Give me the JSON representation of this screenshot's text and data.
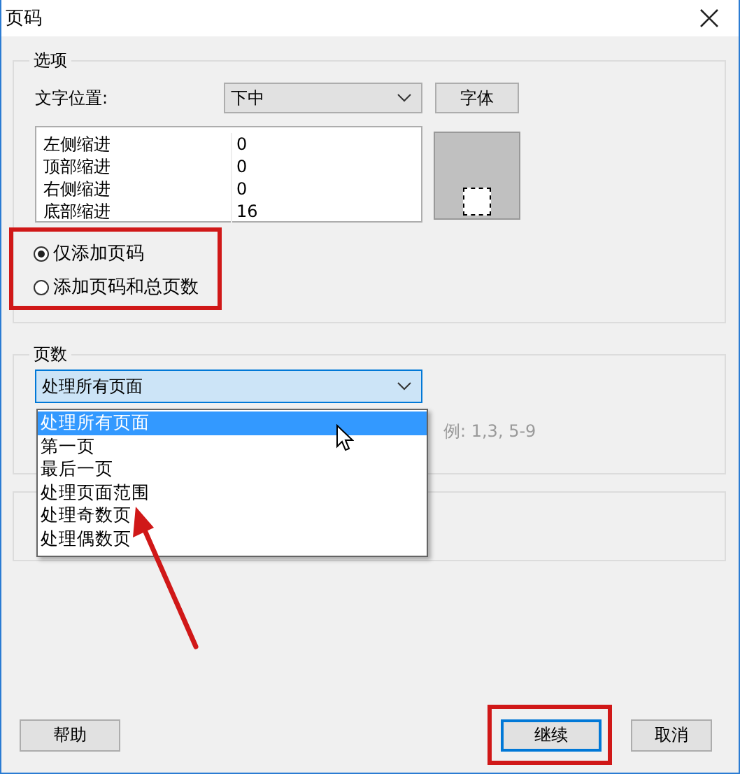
{
  "window": {
    "title": "页码"
  },
  "options": {
    "title": "选项",
    "text_position": {
      "label": "文字位置:",
      "value": "下中"
    },
    "font_button": "字体",
    "margins": [
      {
        "name": "左侧缩进",
        "value": "0"
      },
      {
        "name": "顶部缩进",
        "value": "0"
      },
      {
        "name": "右侧缩进",
        "value": "0"
      },
      {
        "name": "底部缩进",
        "value": "16"
      }
    ],
    "radios": [
      {
        "label": "仅添加页码",
        "selected": true
      },
      {
        "label": "添加页码和总页数",
        "selected": false
      }
    ]
  },
  "pages": {
    "title": "页数",
    "select": {
      "value": "处理所有页面",
      "expanded": true
    },
    "options": [
      {
        "label": "处理所有页面",
        "selected": true
      },
      {
        "label": "第一页",
        "selected": false
      },
      {
        "label": "最后一页",
        "selected": false
      },
      {
        "label": "处理页面范围",
        "selected": false
      },
      {
        "label": "处理奇数页",
        "selected": false
      },
      {
        "label": "处理偶数页",
        "selected": false
      }
    ],
    "hint": "例: 1,3, 5-9"
  },
  "buttons": [
    {
      "label": "帮助",
      "kind": "help"
    },
    {
      "label": "继续",
      "kind": "default"
    },
    {
      "label": "取消",
      "kind": "cancel"
    }
  ]
}
